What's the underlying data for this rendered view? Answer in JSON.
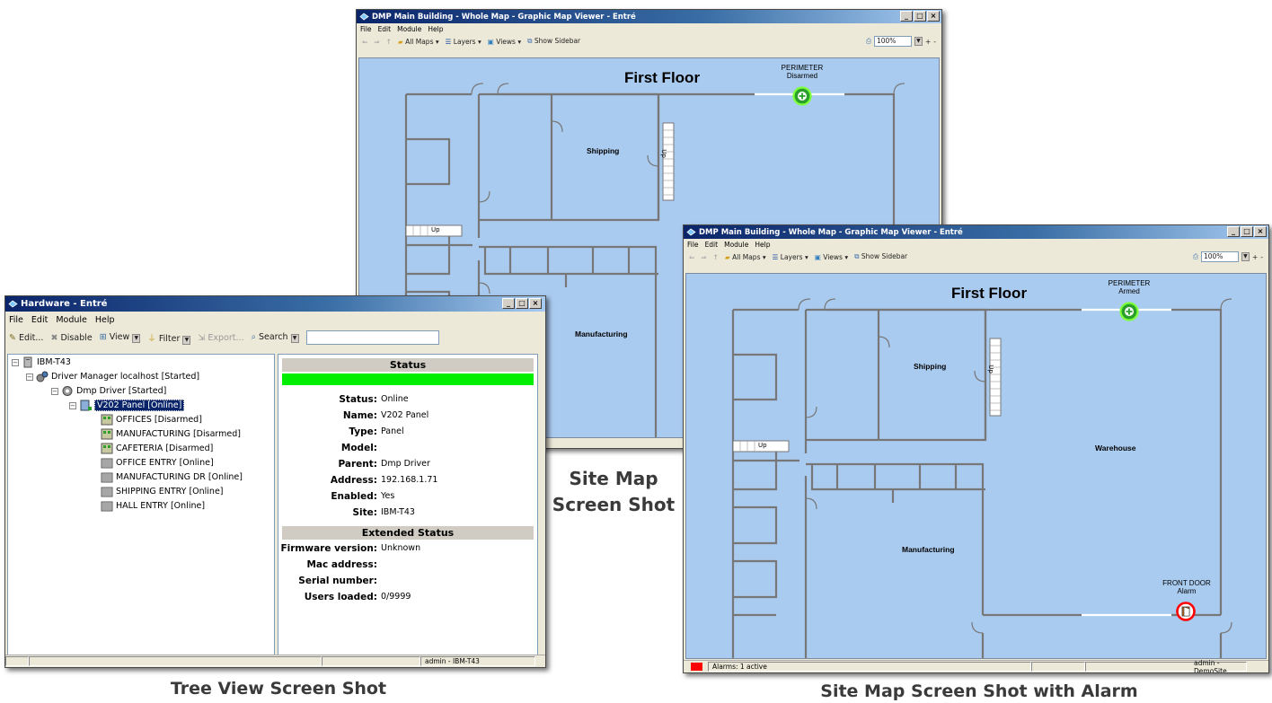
{
  "map1": {
    "title": "DMP Main Building - Whole Map - Graphic Map Viewer - Entré",
    "menu": [
      "File",
      "Edit",
      "Module",
      "Help"
    ],
    "toolbar": {
      "all_maps": "All Maps",
      "layers": "Layers",
      "views": "Views",
      "show_sidebar": "Show Sidebar",
      "zoom": "100%",
      "plus": "+",
      "minus": "-"
    },
    "floor_title": "First Floor",
    "zone": {
      "name": "PERIMETER",
      "state": "Disarmed"
    },
    "rooms": {
      "shipping": "Shipping",
      "manufacturing": "Manufacturing"
    },
    "stairs_up": "Up",
    "caption": "Site Map\nScreen Shot"
  },
  "hardware": {
    "title": "Hardware - Entré",
    "menu": [
      "File",
      "Edit",
      "Module",
      "Help"
    ],
    "toolbar": {
      "edit": "Edit...",
      "disable": "Disable",
      "view": "View",
      "filter": "Filter",
      "export": "Export...",
      "search": "Search",
      "search_value": ""
    },
    "tree": [
      "IBM-T43",
      "Driver Manager localhost [Started]",
      "Dmp Driver [Started]",
      "V202 Panel [Online]",
      "OFFICES [Disarmed]",
      "MANUFACTURING [Disarmed]",
      "CAFETERIA [Disarmed]",
      "OFFICE ENTRY [Online]",
      "MANUFACTURING DR [Online]",
      "SHIPPING ENTRY [Online]",
      "HALL ENTRY [Online]"
    ],
    "status_header": "Status",
    "status_bar_color": "#00ee00",
    "status": [
      {
        "k": "Status:",
        "v": "Online"
      },
      {
        "k": "Name:",
        "v": "V202 Panel"
      },
      {
        "k": "Type:",
        "v": "Panel"
      },
      {
        "k": "Model:",
        "v": ""
      },
      {
        "k": "Parent:",
        "v": "Dmp Driver"
      },
      {
        "k": "Address:",
        "v": "192.168.1.71"
      },
      {
        "k": "Enabled:",
        "v": "Yes"
      },
      {
        "k": "Site:",
        "v": "IBM-T43"
      }
    ],
    "ext_header": "Extended Status",
    "ext": [
      {
        "k": "Firmware version:",
        "v": "Unknown"
      },
      {
        "k": "Mac address:",
        "v": ""
      },
      {
        "k": "Serial number:",
        "v": ""
      },
      {
        "k": "Users loaded:",
        "v": "0/9999"
      }
    ],
    "statusbar_user": "admin - IBM-T43",
    "caption": "Tree View Screen Shot"
  },
  "map2": {
    "title": "DMP Main Building - Whole Map - Graphic Map Viewer - Entré",
    "menu": [
      "File",
      "Edit",
      "Module",
      "Help"
    ],
    "toolbar": {
      "all_maps": "All Maps",
      "layers": "Layers",
      "views": "Views",
      "show_sidebar": "Show Sidebar",
      "zoom": "100%",
      "plus": "+",
      "minus": "-"
    },
    "floor_title": "First Floor",
    "zone": {
      "name": "PERIMETER",
      "state": "Armed"
    },
    "door": {
      "name": "FRONT DOOR",
      "state": "Alarm"
    },
    "rooms": {
      "shipping": "Shipping",
      "warehouse": "Warehouse",
      "manufacturing": "Manufacturing"
    },
    "stairs_up": "Up",
    "alarms": "Alarms: 1 active",
    "statusbar_user": "admin - DemoSite",
    "alarm_color": "#ff0000",
    "caption": "Site Map Screen Shot with Alarm"
  }
}
